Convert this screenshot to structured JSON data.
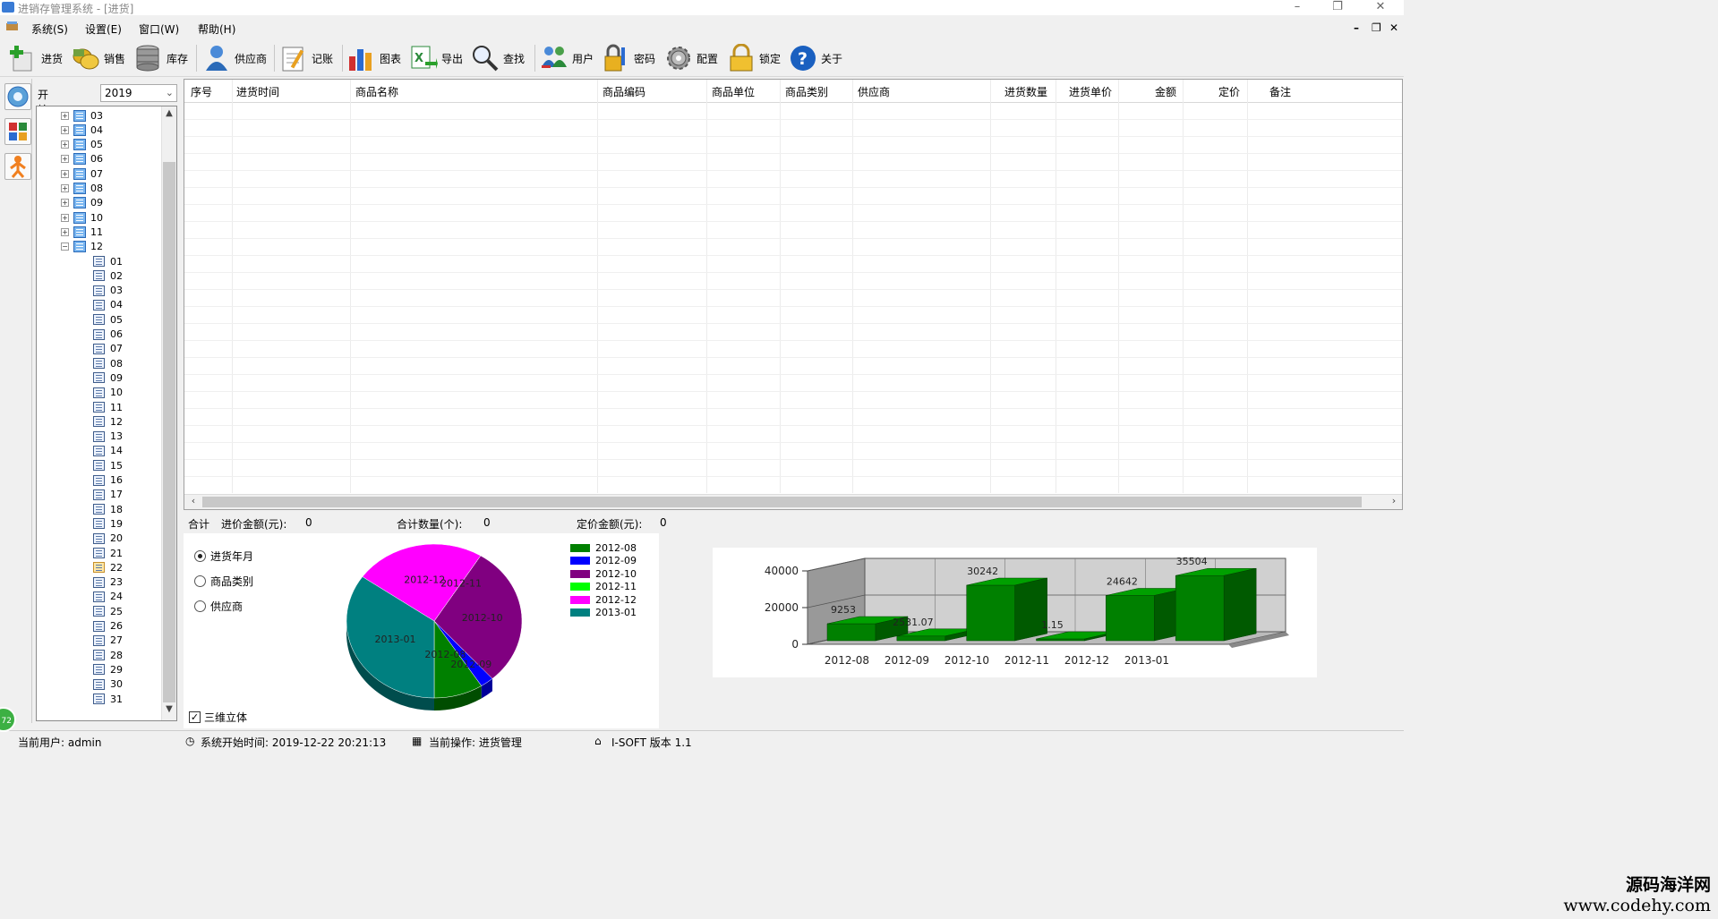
{
  "window": {
    "title": "进销存管理系统 - [进货]"
  },
  "menu": {
    "items": [
      {
        "label": "系统(S)"
      },
      {
        "label": "设置(E)"
      },
      {
        "label": "窗口(W)"
      },
      {
        "label": "帮助(H)"
      }
    ]
  },
  "toolbar": {
    "items": [
      {
        "label": "进货",
        "icon": "add-stock-icon"
      },
      {
        "label": "销售",
        "icon": "coins-icon"
      },
      {
        "label": "库存",
        "icon": "database-icon"
      },
      {
        "label": "供应商",
        "icon": "person-icon"
      },
      {
        "label": "记账",
        "icon": "notepad-icon"
      },
      {
        "label": "图表",
        "icon": "bar-chart-icon"
      },
      {
        "label": "导出",
        "icon": "excel-export-icon"
      },
      {
        "label": "查找",
        "icon": "magnifier-icon"
      },
      {
        "label": "用户",
        "icon": "users-icon"
      },
      {
        "label": "密码",
        "icon": "key-lock-icon"
      },
      {
        "label": "配置",
        "icon": "gear-icon"
      },
      {
        "label": "锁定",
        "icon": "padlock-icon"
      },
      {
        "label": "关于",
        "icon": "help-icon"
      }
    ]
  },
  "filter": {
    "label": "开始年份:",
    "year": "2019"
  },
  "tree": {
    "months": [
      "03",
      "04",
      "05",
      "06",
      "07",
      "08",
      "09",
      "10",
      "11",
      "12"
    ],
    "days": [
      "01",
      "02",
      "03",
      "04",
      "05",
      "06",
      "07",
      "08",
      "09",
      "10",
      "11",
      "12",
      "13",
      "14",
      "15",
      "16",
      "17",
      "18",
      "19",
      "20",
      "21",
      "22",
      "23",
      "24",
      "25",
      "26",
      "27",
      "28",
      "29",
      "30",
      "31"
    ]
  },
  "grid": {
    "columns": [
      "序号",
      "进货时间",
      "商品名称",
      "商品编码",
      "商品单位",
      "商品类别",
      "供应商",
      "进货数量",
      "进货单价",
      "金额",
      "定价",
      "备注"
    ]
  },
  "summary": {
    "label": "合计",
    "cost_label": "进价金额(元):",
    "cost_value": "0",
    "qty_label": "合计数量(个):",
    "qty_value": "0",
    "price_label": "定价金额(元):",
    "price_value": "0"
  },
  "options": {
    "radios": [
      {
        "label": "进货年月",
        "checked": true
      },
      {
        "label": "商品类别",
        "checked": false
      },
      {
        "label": "供应商",
        "checked": false
      }
    ],
    "three_d_label": "三维立体",
    "three_d_checked": true
  },
  "chart_data": [
    {
      "type": "pie",
      "categories": [
        "2012-08",
        "2012-09",
        "2012-10",
        "2012-11",
        "2012-12",
        "2013-01"
      ],
      "values": [
        9253,
        2531.07,
        30242,
        1.15,
        24642,
        35504
      ],
      "colors": [
        "#008000",
        "#0000ff",
        "#800080",
        "#00ff00",
        "#ff00ff",
        "#008080"
      ],
      "legend": "right"
    },
    {
      "type": "bar",
      "categories": [
        "2012-08",
        "2012-09",
        "2012-10",
        "2012-11",
        "2012-12",
        "2013-01"
      ],
      "values": [
        9253,
        2531.07,
        30242,
        1.15,
        24642,
        35504
      ],
      "labels": [
        "9253",
        "2531.07",
        "30242",
        "1.15",
        "24642",
        "35504"
      ],
      "yticks": [
        "40000",
        "20000",
        "0"
      ],
      "ylim": [
        0,
        40000
      ],
      "color": "#008000"
    }
  ],
  "status": {
    "user": "当前用户: admin",
    "start_time": "系统开始时间: 2019-12-22 20:21:13",
    "operation": "当前操作: 进货管理",
    "version": "I-SOFT 版本 1.1"
  },
  "watermark": {
    "line1": "源码海洋网",
    "line2": "www.codehy.com"
  },
  "badge": {
    "text": "72"
  }
}
